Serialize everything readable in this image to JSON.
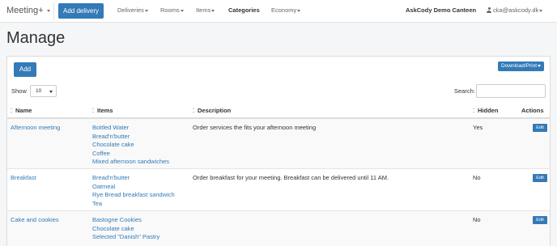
{
  "navbar": {
    "brand": "Meeting+",
    "add_delivery": "Add delivery",
    "menu": [
      {
        "label": "Deliveries",
        "dropdown": true
      },
      {
        "label": "Rooms",
        "dropdown": true
      },
      {
        "label": "Items",
        "dropdown": true
      },
      {
        "label": "Categories",
        "dropdown": false,
        "active": true
      },
      {
        "label": "Economy",
        "dropdown": true
      }
    ],
    "canteen": "AskCody Demo Canteen",
    "user_email": "cka@askcody.dk"
  },
  "page": {
    "title": "Manage"
  },
  "toolbar": {
    "add_label": "Add",
    "download_label": "Download/Print"
  },
  "table_controls": {
    "show_label": "Show",
    "page_size": "10",
    "search_label": "Search:",
    "search_value": ""
  },
  "table": {
    "headers": {
      "name": "Name",
      "items": "Items",
      "description": "Description",
      "hidden": "Hidden",
      "actions": "Actions"
    },
    "rows": [
      {
        "name": "Afternoon meeting",
        "items": [
          "Bottled Water",
          "Bread'n'butter",
          "Chocolate cake",
          "Coffee",
          "Mixed afternoon sandwiches"
        ],
        "description": "Order services the fits your afternoon meeting",
        "hidden": "Yes",
        "action": "Edit"
      },
      {
        "name": "Breakfast",
        "items": [
          "Bread'n'butter",
          "Oatmeal",
          "Rye Bread breakfast sandwich",
          "Tea"
        ],
        "description": "Order breakfast for your meeting. Breakfast can be delivered until 11 AM.",
        "hidden": "No",
        "action": "Edit"
      },
      {
        "name": "Cake and cookies",
        "items": [
          "Bastogne Cookies",
          "Chocolate cake",
          "Selected \"Danish\" Pastry"
        ],
        "description": "",
        "hidden": "No",
        "action": "Edit"
      }
    ]
  },
  "colors": {
    "primary": "#337ab7",
    "link": "#337ab7"
  },
  "icons": {
    "user": "user-icon",
    "sort": "sort-icon",
    "caret": "caret-down-icon"
  }
}
